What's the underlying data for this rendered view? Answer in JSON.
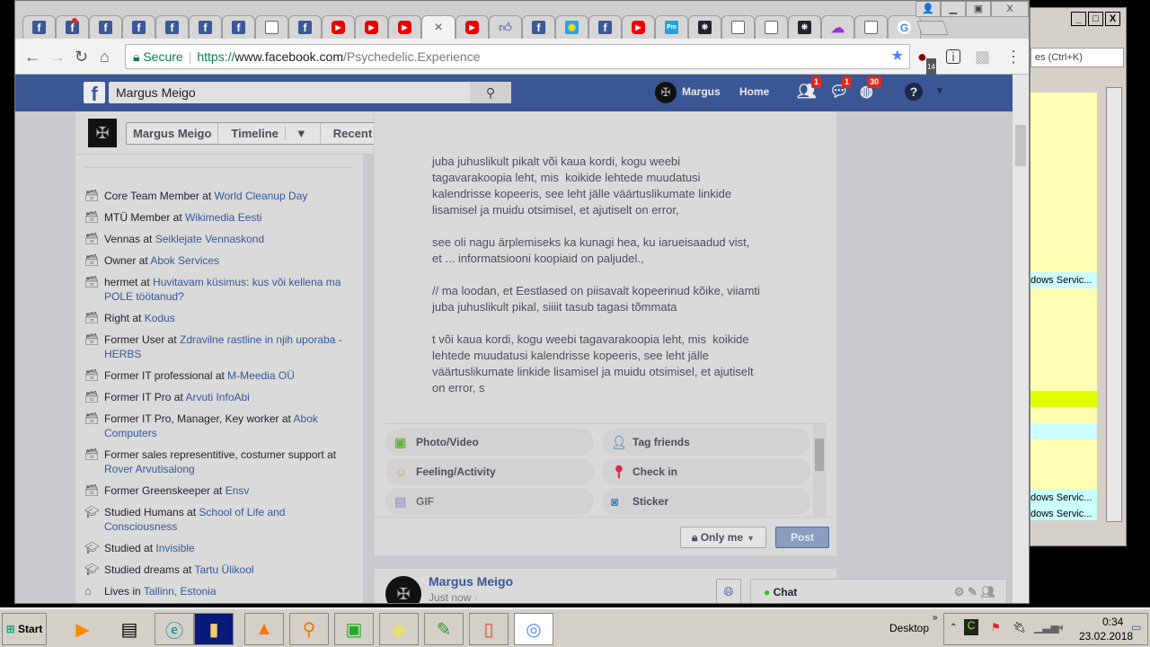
{
  "browser": {
    "tabs": [
      "fb",
      "fb-notif",
      "fb",
      "fb",
      "fb",
      "fb",
      "fb",
      "doc",
      "fb",
      "yt",
      "yt",
      "yt",
      "active",
      "yt",
      "like",
      "fb",
      "sun",
      "fb",
      "yt",
      "pm",
      "tele",
      "doc",
      "doc",
      "tele",
      "purp",
      "doc",
      "goog"
    ],
    "active_tab_close": "×",
    "secure": "Secure",
    "url_scheme": "https://",
    "url_host": "www.facebook.com",
    "url_path": "/Psychedelic.Experience",
    "ext_badge": "14"
  },
  "bgwindow": {
    "search_placeholder": "es (Ctrl+K)",
    "rows": [
      "dows Servic...",
      "dows Servic...",
      "dows Servic..."
    ]
  },
  "fb": {
    "search": "Margus Meigo",
    "user": "Margus",
    "home": "Home",
    "friend_badge": "1",
    "msg_badge": "1",
    "notif_badge": "30"
  },
  "profile": {
    "name_btn": "Margus Meigo",
    "timeline_btn": "Timeline",
    "recent_btn": "Recent"
  },
  "intro": [
    {
      "icon": "work",
      "pre": "Core Team Member at ",
      "link": "World Cleanup Day"
    },
    {
      "icon": "work",
      "pre": "MTÜ Member at ",
      "link": "Wikimedia Eesti"
    },
    {
      "icon": "work",
      "pre": "Vennas at ",
      "link": "Seiklejate Vennaskond"
    },
    {
      "icon": "work",
      "pre": "Owner at ",
      "link": "Abok Services"
    },
    {
      "icon": "work",
      "pre": "hermet at ",
      "link": "Huvitavam küsimus: kus või kellena ma POLE töötanud?"
    },
    {
      "icon": "work",
      "pre": "Right at ",
      "link": "Kodus"
    },
    {
      "icon": "work",
      "pre": "Former User at ",
      "link": "Zdravilne rastline in njih uporaba - HERBS"
    },
    {
      "icon": "work",
      "pre": "Former IT professional at ",
      "link": "M-Meedia OÜ"
    },
    {
      "icon": "work",
      "pre": "Former IT Pro at ",
      "link": "Arvuti InfoAbi"
    },
    {
      "icon": "work",
      "pre": "Former IT Pro, Manager, Key worker at ",
      "link": "Abok Computers"
    },
    {
      "icon": "work",
      "pre": "Former sales representitive, costumer support at ",
      "link": "Rover Arvutisalong"
    },
    {
      "icon": "work",
      "pre": "Former Greenskeeper at ",
      "link": "Ensv"
    },
    {
      "icon": "school",
      "pre": "Studied Humans at ",
      "link": "School of Life and Consciousness"
    },
    {
      "icon": "school",
      "pre": "Studied at ",
      "link": "Invisible"
    },
    {
      "icon": "school",
      "pre": "Studied dreams at ",
      "link": "Tartu Ülikool"
    },
    {
      "icon": "home",
      "pre": "Lives in ",
      "link": "Tallinn, Estonia"
    }
  ],
  "post": {
    "text": "juba juhuslikult pikalt või kaua kordi, kogu weebi\ntagavarakoopia leht, mis  koikide lehtede muudatusi\nkalendrisse kopeeris, see leht jälle väärtuslikumate linkide\nlisamisel ja muidu otsimisel, et ajutiselt on error,\n\nsee oli nagu ärplemiseks ka kunagi hea, ku iarueisaadud vist,\net ... informatsiooni koopiaid on paljudel.,\n\n// ma loodan, et Eestlased on piisavalt kopeerinud kõike, viiamti\njuba juhuslikult pikal, siiiit tasub tagasi tõmmata\n\nt või kaua kordi, kogu weebi tagavarakoopia leht, mis  koikide\nlehtede muudatusi kalendrisse kopeeris, see leht jälle\nväärtuslikumate linkide lisamisel ja muidu otsimisel, et ajutiselt\non error, s",
    "actions": [
      "Photo/Video",
      "Tag friends",
      "Feeling/Activity",
      "Check in",
      "GIF",
      "Sticker"
    ],
    "privacy": "Only me",
    "post_btn": "Post"
  },
  "post2": {
    "author": "Margus Meigo",
    "time": "Just now · "
  },
  "chat": {
    "label": "Chat"
  },
  "taskbar": {
    "start": "Start",
    "desktop": "Desktop",
    "time": "0:34",
    "date": "23.02.2018"
  },
  "colors": {
    "fb_blue": "#3b5998",
    "link": "#365899"
  }
}
